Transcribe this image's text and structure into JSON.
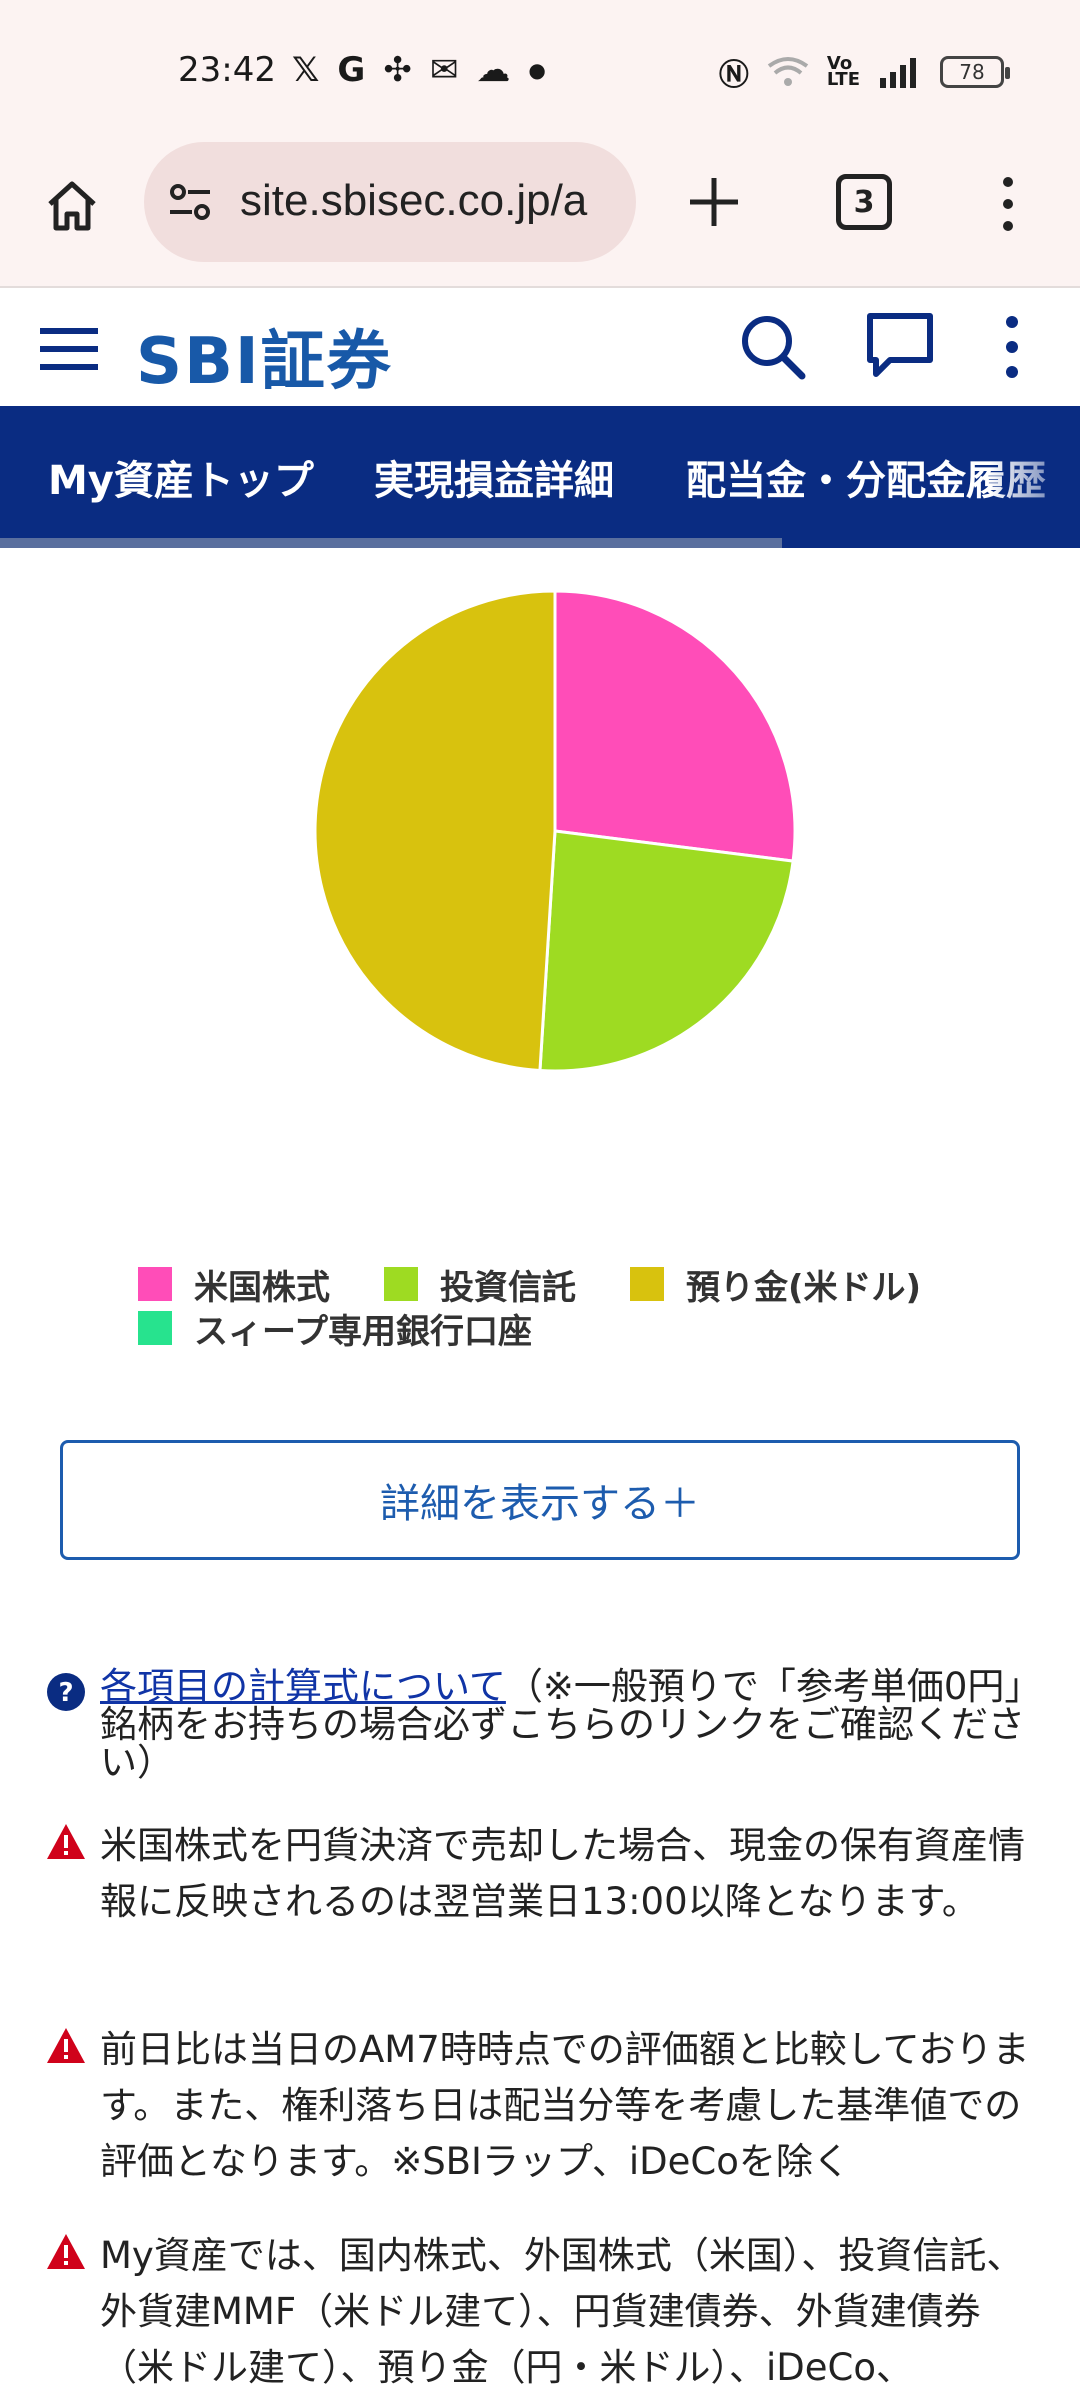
{
  "status_bar": {
    "time": "23:42",
    "left_icons": [
      "x-icon",
      "google-icon",
      "pinwheel-icon",
      "mail-icon",
      "cloud-icon",
      "dot-icon"
    ],
    "right_icons": [
      "nfc-icon",
      "wifi-icon",
      "volte-icon",
      "signal-icon"
    ],
    "battery": "78"
  },
  "browser": {
    "url": "site.sbisec.co.jp/a",
    "tab_count": "3"
  },
  "site_header": {
    "logo": "SBI証券"
  },
  "nav": {
    "tabs": [
      {
        "label": "My資産トップ"
      },
      {
        "label": "実現損益詳細"
      },
      {
        "label": "配当金・分配金履歴"
      }
    ]
  },
  "chart_data": {
    "type": "pie",
    "slices": [
      {
        "label": "米国株式",
        "value": 27,
        "color": "#ff4db8"
      },
      {
        "label": "投資信託",
        "value": 24,
        "color": "#9edb22"
      },
      {
        "label": "預り金(米ドル)",
        "value": 49,
        "color": "#d8c20e"
      },
      {
        "label": "スィープ専用銀行口座",
        "value": 0,
        "color": "#27e38e"
      }
    ],
    "legend_position": "bottom"
  },
  "legend": {
    "items": [
      {
        "label": "米国株式",
        "color": "#ff4db8"
      },
      {
        "label": "投資信託",
        "color": "#9edb22"
      },
      {
        "label": "預り金(米ドル)",
        "color": "#d8c20e"
      },
      {
        "label": "スィープ専用銀行口座",
        "color": "#27e38e"
      }
    ]
  },
  "details_button": {
    "label": "詳細を表示する＋"
  },
  "notes": {
    "calc_link": "各項目の計算式について",
    "calc_text": "（※一般預りで「参考単価0円」銘柄をお持ちの場合必ずこちらのリンクをご確認ください）",
    "warning_1": "米国株式を円貨決済で売却した場合、現金の保有資産情報に反映されるのは翌営業日13:00以降となります。",
    "warning_2": "前日比は当日のAM7時時点での評価額と比較しております。また、権利落ち日は配当分等を考慮した基準値での評価となります。※SBIラップ、iDeCoを除く",
    "warning_3": "My資産では、国内株式、外国株式（米国）、投資信託、外貨建MMF（米ドル建て）、円貨建債券、外貨建債券（米ドル建て）、預り金（円・米ドル）、iDeCo、"
  }
}
